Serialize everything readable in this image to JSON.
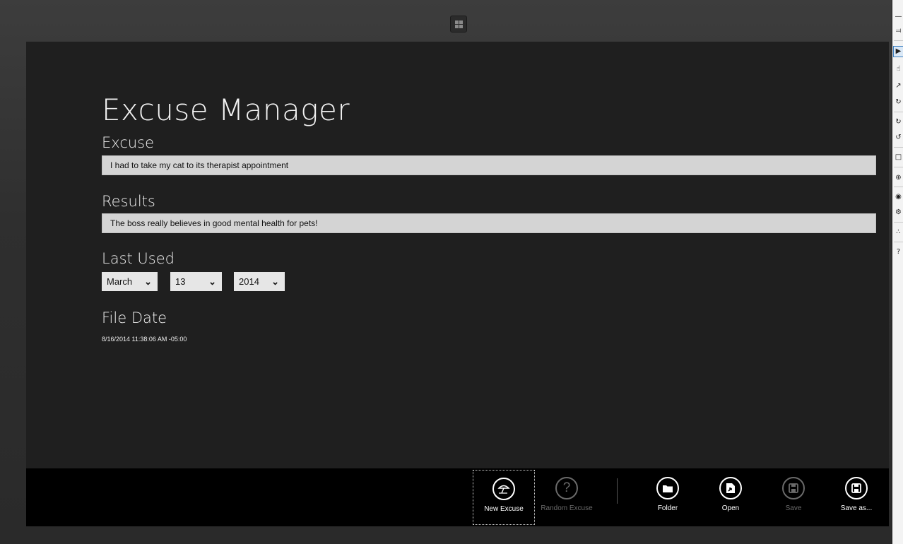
{
  "app": {
    "title": "Excuse Manager"
  },
  "form": {
    "excuse_label": "Excuse",
    "excuse_value": "I had to take my cat to its therapist appointment",
    "results_label": "Results",
    "results_value": "The boss really believes in good mental health for pets!",
    "last_used_label": "Last Used",
    "month": "March",
    "day": "13",
    "year": "2014",
    "file_date_label": "File Date",
    "file_date_value": "8/16/2014 11:38:06 AM -05:00"
  },
  "appbar": {
    "new_excuse": "New Excuse",
    "random_excuse": "Random Excuse",
    "folder": "Folder",
    "open": "Open",
    "save": "Save",
    "save_as": "Save as..."
  },
  "simulator_toolbar": {
    "icons": [
      "minimize-icon",
      "pin-icon",
      "pointer-mode-icon",
      "touch-mode-icon",
      "pinch-zoom-icon",
      "rotate-touch-icon",
      "rotate-clockwise-icon",
      "rotate-counterclockwise-icon",
      "change-resolution-icon",
      "set-location-icon",
      "screenshot-icon",
      "screenshot-settings-icon",
      "network-icon",
      "help-icon"
    ],
    "help_glyph": "?"
  },
  "colors": {
    "screen_bg": "#1f1f1f",
    "field_bg": "#d4d4d4",
    "appbar_bg": "#000000",
    "disabled": "#6a6a6a"
  }
}
